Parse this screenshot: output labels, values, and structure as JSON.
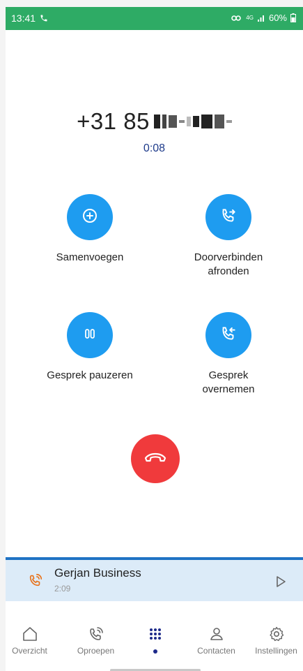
{
  "status_bar": {
    "time": "13:41",
    "network": "4G",
    "battery": "60%",
    "background_color": "#2eab65"
  },
  "call": {
    "number_visible_prefix": "+31 85",
    "number_redacted": true,
    "timer": "0:08"
  },
  "actions": [
    {
      "label": "Samenvoegen",
      "icon": "merge-plus-icon"
    },
    {
      "label": "Doorverbinden\nafronden",
      "icon": "phone-transfer-icon"
    },
    {
      "label": "Gesprek pauzeren",
      "icon": "pause-icon"
    },
    {
      "label": "Gesprek\novernemen",
      "icon": "phone-incoming-icon"
    }
  ],
  "hangup": {
    "icon": "hangup-icon",
    "color": "#f03a3c"
  },
  "active_call": {
    "name": "Gerjan Business",
    "duration": "2:09",
    "accent_color": "#1f73c4"
  },
  "nav": {
    "items": [
      {
        "label": "Overzicht",
        "icon": "home-icon"
      },
      {
        "label": "Oproepen",
        "icon": "calls-icon"
      },
      {
        "label": "",
        "icon": "dialpad-icon",
        "active": true
      },
      {
        "label": "Contacten",
        "icon": "person-icon"
      },
      {
        "label": "Instellingen",
        "icon": "gear-icon"
      }
    ]
  },
  "colors": {
    "accent_blue": "#1e9cf0",
    "timer_blue": "#1d3a8a",
    "call_orange": "#e8731c"
  }
}
